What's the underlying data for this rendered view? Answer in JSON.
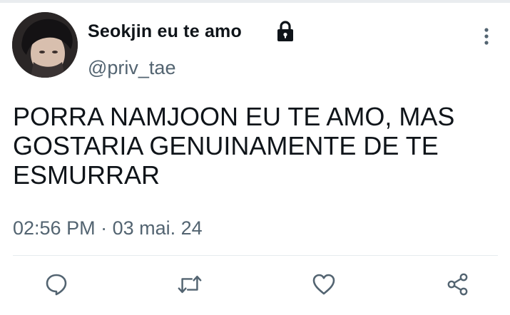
{
  "tweet": {
    "display_name": "Seokjin eu te amo",
    "handle": "@priv_tae",
    "protected_icon": "lock-icon",
    "text": "PORRA NAMJOON EU TE AMO, MAS GOSTARIA GENUINAMENTE DE TE ESMURRAR",
    "time": "02:56 PM",
    "separator": "·",
    "date": "03 mai. 24"
  },
  "icons": {
    "more": "vertical-ellipsis-icon",
    "reply": "comment-icon",
    "retweet": "retweet-icon",
    "like": "heart-icon",
    "share": "share-icon"
  },
  "colors": {
    "text": "#0f1419",
    "secondary": "#536471",
    "divider": "#e6ebee",
    "icon": "#536471"
  }
}
